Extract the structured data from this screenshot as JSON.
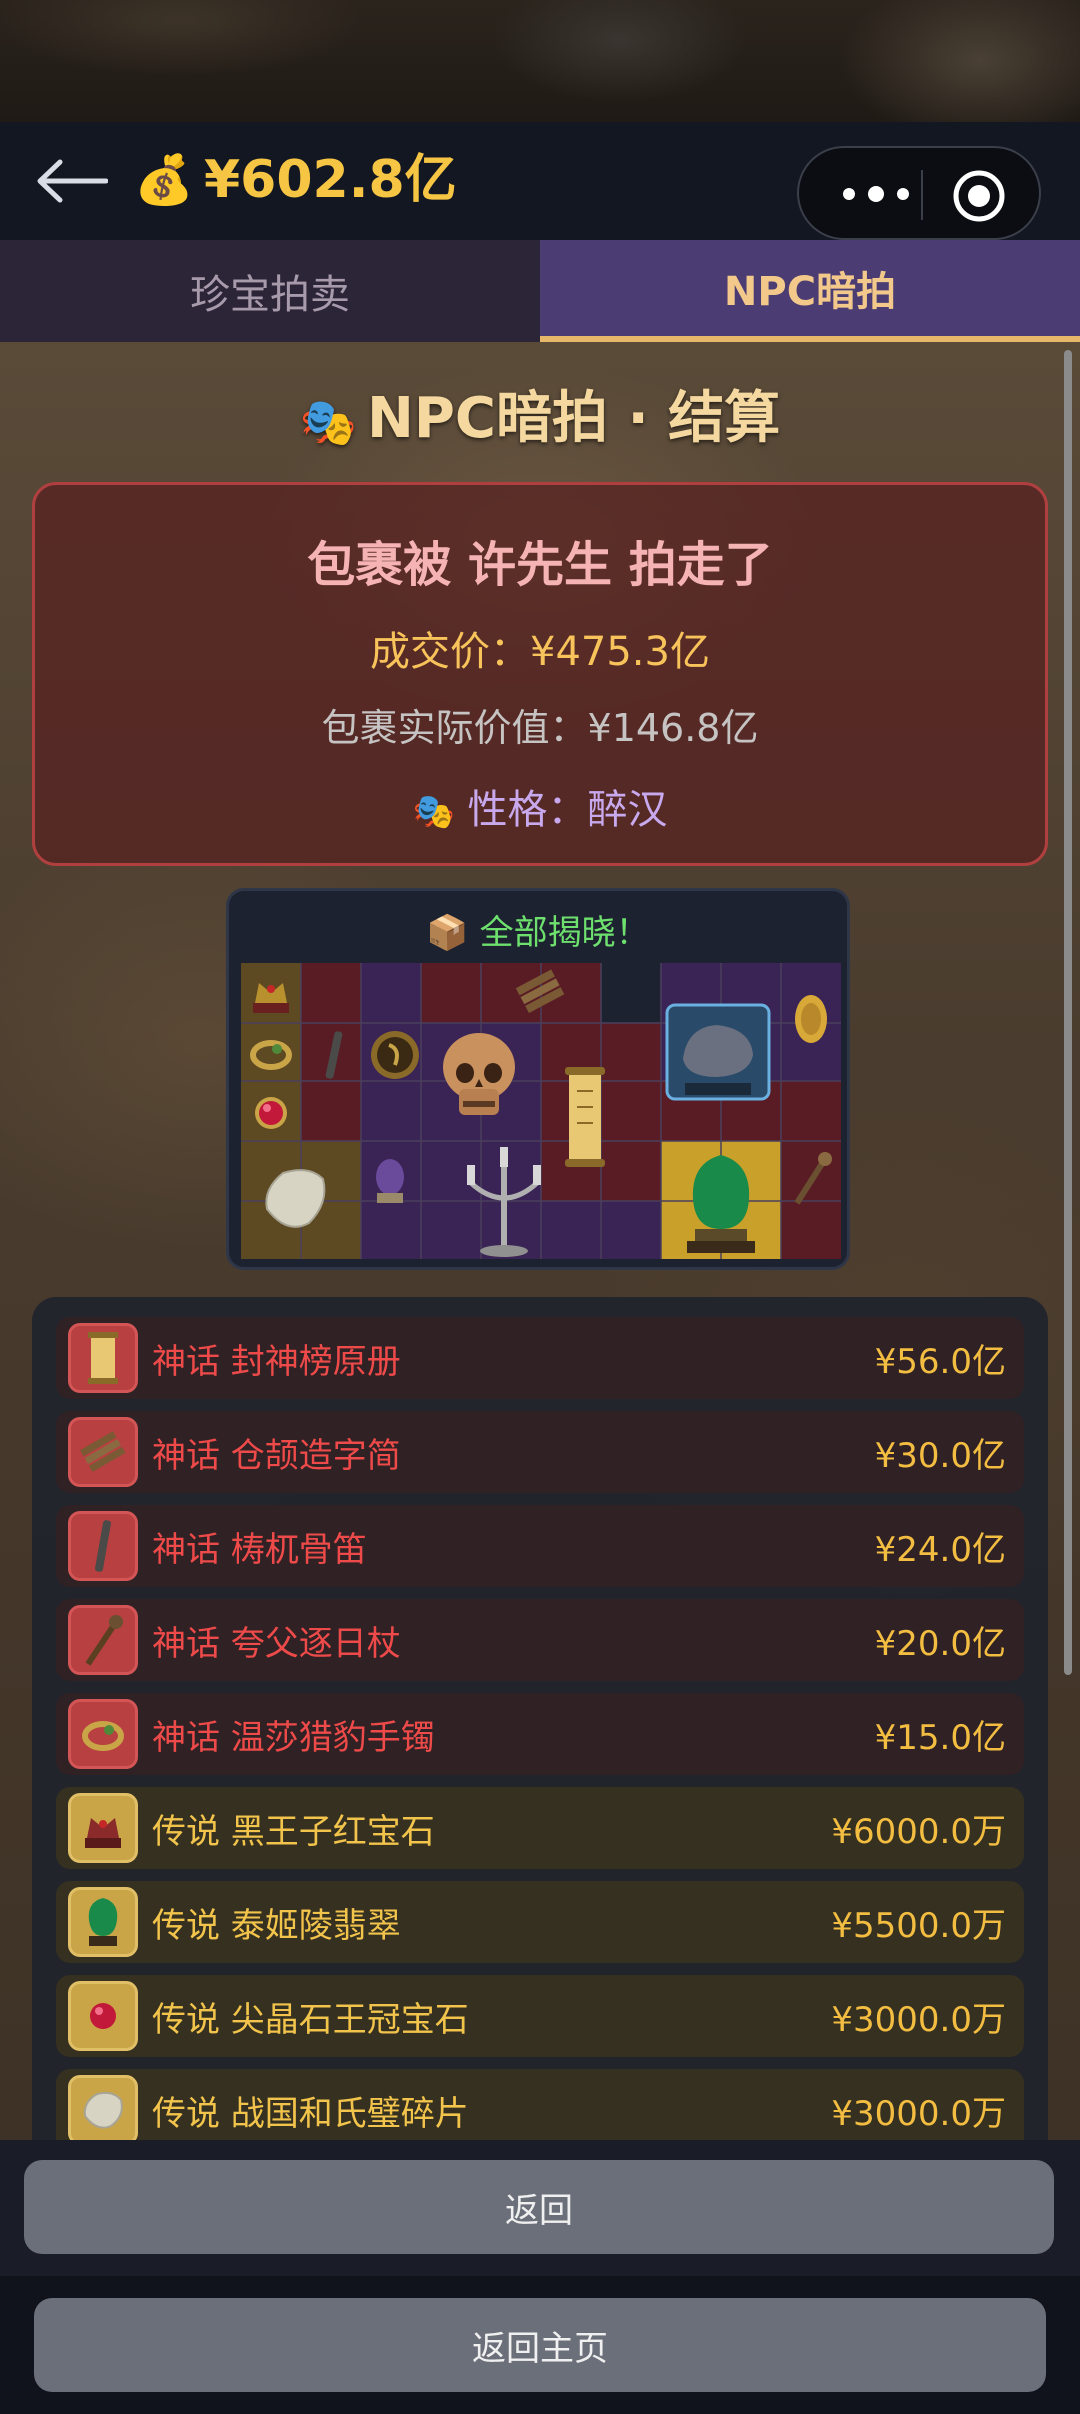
{
  "header": {
    "balance": "¥602.8亿",
    "coin_emoji": "💰"
  },
  "tabs": [
    {
      "label": "珍宝拍卖",
      "active": false
    },
    {
      "label": "NPC暗拍",
      "active": true
    }
  ],
  "result": {
    "title": "NPC暗拍 · 结算",
    "masks_emoji": "🎭",
    "winner_line": "包裹被 许先生 拍走了",
    "deal_price": "成交价：¥475.3亿",
    "actual_value": "包裹实际价值：¥146.8亿",
    "personality": "性格：醉汉"
  },
  "reveal": {
    "title": "📦 全部揭晓！"
  },
  "items": [
    {
      "rarity": "myth",
      "name": "神话 封神榜原册",
      "price": "¥56.0亿",
      "icon": "scroll-icon"
    },
    {
      "rarity": "myth",
      "name": "神话 仓颉造字简",
      "price": "¥30.0亿",
      "icon": "bamboo-slips-icon"
    },
    {
      "rarity": "myth",
      "name": "神话 梼杌骨笛",
      "price": "¥24.0亿",
      "icon": "bone-flute-icon"
    },
    {
      "rarity": "myth",
      "name": "神话 夸父逐日杖",
      "price": "¥20.0亿",
      "icon": "staff-icon"
    },
    {
      "rarity": "myth",
      "name": "神话 温莎猎豹手镯",
      "price": "¥15.0亿",
      "icon": "bracelet-icon"
    },
    {
      "rarity": "legend",
      "name": "传说 黑王子红宝石",
      "price": "¥6000.0万",
      "icon": "crown-icon"
    },
    {
      "rarity": "legend",
      "name": "传说 泰姬陵翡翠",
      "price": "¥5500.0万",
      "icon": "emerald-icon"
    },
    {
      "rarity": "legend",
      "name": "传说 尖晶石王冠宝石",
      "price": "¥3000.0万",
      "icon": "ruby-icon"
    },
    {
      "rarity": "legend",
      "name": "传说 战国和氏璧碎片",
      "price": "¥3000.0万",
      "icon": "jade-shard-icon"
    }
  ],
  "buttons": {
    "back": "返回",
    "home": "返回主页"
  },
  "colors": {
    "balance": "#f6c544",
    "myth": "#ef4a4a",
    "legend": "#f2c44c",
    "price": "#f3bd42"
  }
}
